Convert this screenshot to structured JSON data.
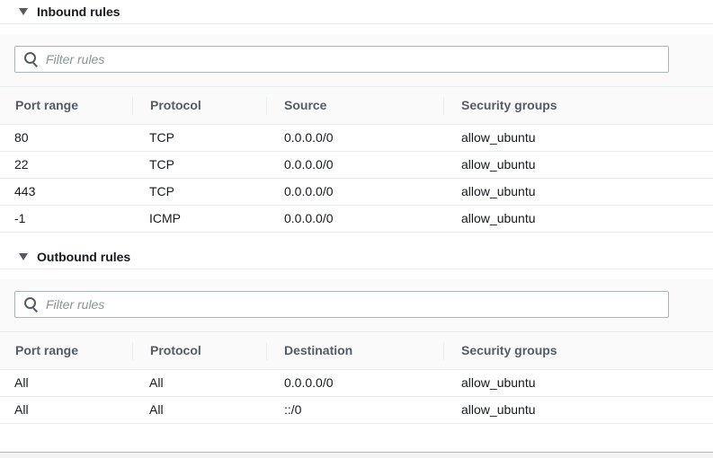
{
  "inbound": {
    "title": "Inbound rules",
    "filter_placeholder": "Filter rules",
    "columns": [
      "Port range",
      "Protocol",
      "Source",
      "Security groups"
    ],
    "rows": [
      [
        "80",
        "TCP",
        "0.0.0.0/0",
        "allow_ubuntu"
      ],
      [
        "22",
        "TCP",
        "0.0.0.0/0",
        "allow_ubuntu"
      ],
      [
        "443",
        "TCP",
        "0.0.0.0/0",
        "allow_ubuntu"
      ],
      [
        "-1",
        "ICMP",
        "0.0.0.0/0",
        "allow_ubuntu"
      ]
    ]
  },
  "outbound": {
    "title": "Outbound rules",
    "filter_placeholder": "Filter rules",
    "columns": [
      "Port range",
      "Protocol",
      "Destination",
      "Security groups"
    ],
    "rows": [
      [
        "All",
        "All",
        "0.0.0.0/0",
        "allow_ubuntu"
      ],
      [
        "All",
        "All",
        "::/0",
        "allow_ubuntu"
      ]
    ]
  }
}
